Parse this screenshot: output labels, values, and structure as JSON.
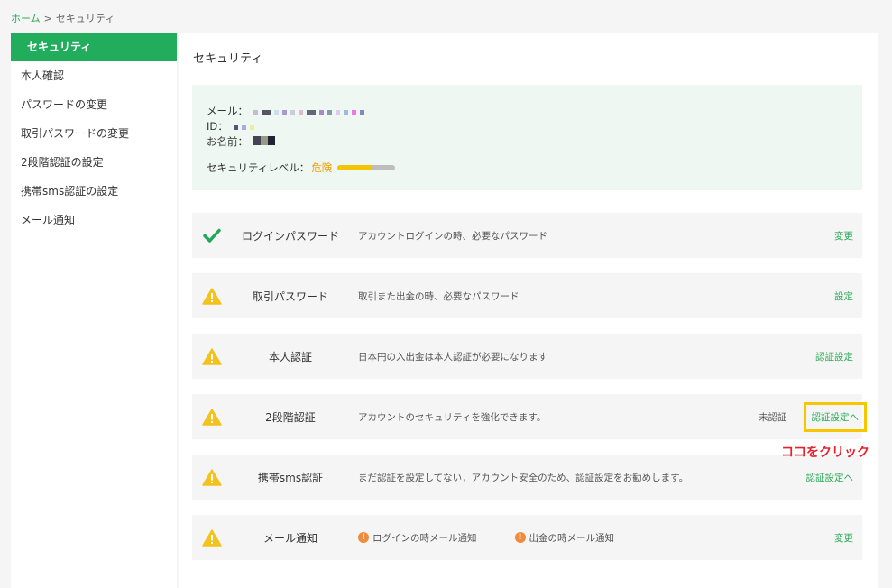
{
  "breadcrumb": {
    "home": "ホーム",
    "separator": ">",
    "current": "セキュリティ"
  },
  "sidebar": {
    "active": "セキュリティ",
    "items": [
      {
        "label": "本人確認"
      },
      {
        "label": "パスワードの変更"
      },
      {
        "label": "取引パスワードの変更"
      },
      {
        "label": "2段階認証の設定"
      },
      {
        "label": "携帯sms認証の設定"
      },
      {
        "label": "メール通知"
      }
    ]
  },
  "main": {
    "title": "セキュリティ",
    "info": {
      "mail_label": "メール：",
      "id_label": "ID：",
      "name_label": "お名前：",
      "level_label": "セキュリティレベル：",
      "level_value": "危険",
      "level_fraction": 0.6
    },
    "rows": [
      {
        "icon": "check-icon",
        "name": "ログインパスワード",
        "desc": "アカウントログインの時、必要なパスワード",
        "action": "変更"
      },
      {
        "icon": "warning-icon",
        "name": "取引パスワード",
        "desc": "取引また出金の時、必要なパスワード",
        "action": "設定"
      },
      {
        "icon": "warning-icon",
        "name": "本人認証",
        "desc": "日本円の入出金は本人認証が必要になります",
        "action": "認証設定"
      },
      {
        "icon": "warning-icon",
        "name": "2段階認証",
        "desc": "アカウントのセキュリティを強化できます。",
        "status": "未認証",
        "action": "認証設定へ"
      },
      {
        "icon": "warning-icon",
        "name": "携帯sms認証",
        "desc": "まだ認証を設定してない，アカウント安全のため、認証設定をお勧めします。",
        "action": "認証設定へ"
      },
      {
        "icon": "warning-icon",
        "name": "メール通知",
        "options": [
          "ログインの時メール通知",
          "出金の時メール通知"
        ],
        "action": "変更"
      }
    ]
  },
  "annotation": "ココをクリック",
  "colors": {
    "accent": "#22ad5c",
    "warning": "#f5c400",
    "danger": "#f0a000",
    "highlight": "#f7c600",
    "annotation": "#e8202a"
  }
}
